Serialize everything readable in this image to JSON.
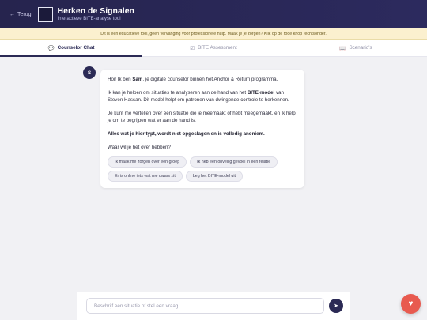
{
  "header": {
    "back_label": "Terug",
    "back_icon": "arrow-left-icon",
    "title": "Herken de Signalen",
    "subtitle": "Interactieve BITE-analyse tool"
  },
  "notice": {
    "text": "Dit is een educatieve tool, geen vervanging voor professionele hulp. Maak je je zorgen? Klik op de rode knop rechtsonder."
  },
  "tabs": [
    {
      "label": "Counselor Chat",
      "icon": "chat-bubble-icon",
      "active": true
    },
    {
      "label": "BITE Assessment",
      "icon": "checkbox-icon",
      "active": false
    },
    {
      "label": "Scenario's",
      "icon": "book-icon",
      "active": false
    }
  ],
  "message": {
    "avatar_letter": "S",
    "greeting_pre": "Hoi! Ik ben ",
    "greeting_name": "Sam",
    "greeting_post": ", je digitale counselor binnen het Anchor & Return programma.",
    "p2_pre": "Ik kan je helpen om situaties te analyseren aan de hand van het ",
    "p2_bold": "BITE-model",
    "p2_post": " van Steven Hassan. Dit model helpt om patronen van dwingende controle te herkennen.",
    "p3": "Je kunt me vertellen over een situatie die je meemaakt of hebt meegemaakt, en ik help je om te begrijpen wat er aan de hand is.",
    "p4": "Alles wat je hier typt, wordt niet opgeslagen en is volledig anoniem.",
    "p5": "Waar wil je het over hebben?"
  },
  "suggestions": [
    "Ik maak me zorgen over een groep",
    "Ik heb een onveilig gevoel in een relatie",
    "Er is online iets wat me dwars zit",
    "Leg het BITE-model uit"
  ],
  "composer": {
    "placeholder": "Beschrijf een situatie of stel een vraag...",
    "value": "",
    "send_icon": "send-arrow-icon"
  },
  "help_button": {
    "icon": "heart-icon",
    "color": "#e85a4f"
  },
  "colors": {
    "primary": "#2b2a55",
    "notice_bg": "#fbf0cf",
    "alert": "#e85a4f"
  }
}
